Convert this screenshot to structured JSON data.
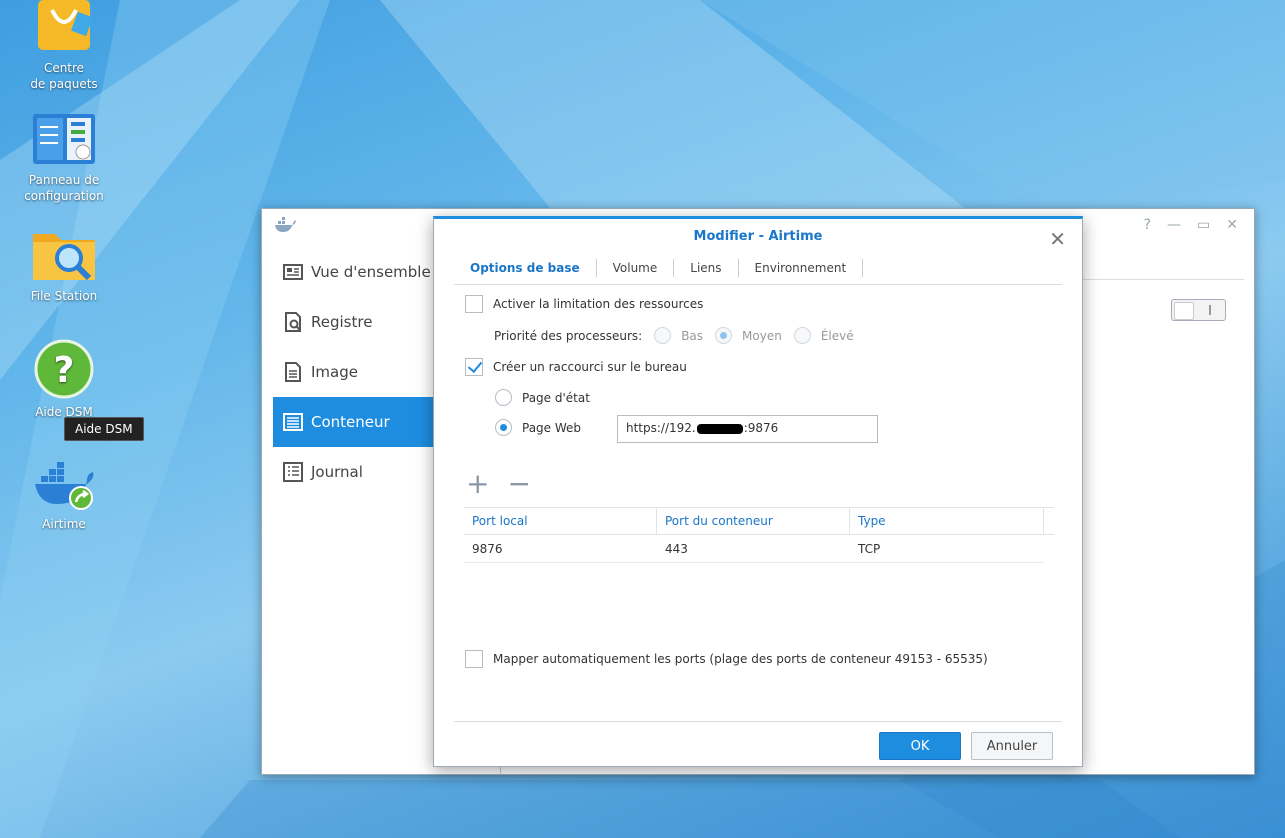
{
  "desktop": {
    "icons": [
      {
        "label_line1": "Centre",
        "label_line2": "de paquets"
      },
      {
        "label_line1": "Panneau de",
        "label_line2": "configuration"
      },
      {
        "label_line1": "File Station",
        "label_line2": ""
      },
      {
        "label_line1": "Aide DSM",
        "label_line2": ""
      },
      {
        "label_line1": "Airtime",
        "label_line2": ""
      }
    ],
    "tooltip": "Aide DSM"
  },
  "main_window": {
    "controls": [
      "?",
      "—",
      "▭",
      "✕"
    ],
    "sidebar": [
      {
        "label": "Vue d'ensemble",
        "icon": "overview-icon",
        "active": false
      },
      {
        "label": "Registre",
        "icon": "registry-icon",
        "active": false
      },
      {
        "label": "Image",
        "icon": "image-icon",
        "active": false
      },
      {
        "label": "Conteneur",
        "icon": "container-icon",
        "active": true
      },
      {
        "label": "Journal",
        "icon": "log-icon",
        "active": false
      }
    ]
  },
  "dialog": {
    "title": "Modifier - Airtime",
    "tabs": [
      "Options de base",
      "Volume",
      "Liens",
      "Environnement"
    ],
    "active_tab": 0,
    "resource_limit_label": "Activer la limitation des ressources",
    "resource_limit_checked": false,
    "cpu_priority_label": "Priorité des processeurs:",
    "cpu_options": [
      "Bas",
      "Moyen",
      "Élevé"
    ],
    "cpu_selected": "Moyen",
    "shortcut_label": "Créer un raccourci sur le bureau",
    "shortcut_checked": true,
    "status_page_label": "Page d'état",
    "web_page_label": "Page Web",
    "web_page_selected": true,
    "url_prefix": "https://192.",
    "url_suffix": ":9876",
    "ports_table": {
      "headers": [
        "Port local",
        "Port du conteneur",
        "Type"
      ],
      "rows": [
        [
          "9876",
          "443",
          "TCP"
        ]
      ]
    },
    "automap_label": "Mapper automatiquement les ports (plage des ports de conteneur 49153 - 65535)",
    "automap_checked": false,
    "ok_label": "OK",
    "cancel_label": "Annuler"
  },
  "colors": {
    "accent": "#1e8de0",
    "link_blue": "#1a76c8"
  }
}
